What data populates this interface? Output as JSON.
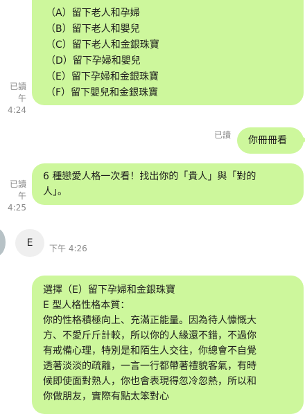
{
  "messages": {
    "options_bubble": {
      "options": [
        "（A）留下老人和孕婦",
        "（B）留下老人和嬰兒",
        "（C）留下老人和金銀珠寶",
        "（D）留下孕婦和嬰兒",
        "（E）留下孕婦和金銀珠寶",
        "（F）留下嬰兒和金銀珠寶"
      ],
      "read_label": "已讀",
      "time": "午 4:24"
    },
    "reply_bubble": {
      "text": "你冊冊看",
      "read_label": "已讀"
    },
    "intro_bubble": {
      "line1": "6 種戀愛人格一次看！找出你的「貴人」與「對的",
      "line2": "人」。",
      "read_label": "已讀",
      "time": "午 4:25"
    },
    "incoming": {
      "text": "E",
      "time": "下午 4:26"
    },
    "result_bubble": {
      "lines": [
        "選擇（E）留下孕婦和金銀珠寶",
        "E 型人格性格本質：",
        "你的性格積極向上、充滿正能量。因為待人慷慨大",
        "方、不愛斤斤計較，所以你的人緣還不錯，不過你",
        "有戒備心理，特別是和陌生人交往，你總會不自覺",
        "透著淡淡的疏離，一言一行都帶著禮貌客氣，有時",
        "候即使面對熟人，你也會表現得忽冷忽熱，所以和",
        "你做朋友，實際有點太笨對心"
      ]
    }
  }
}
